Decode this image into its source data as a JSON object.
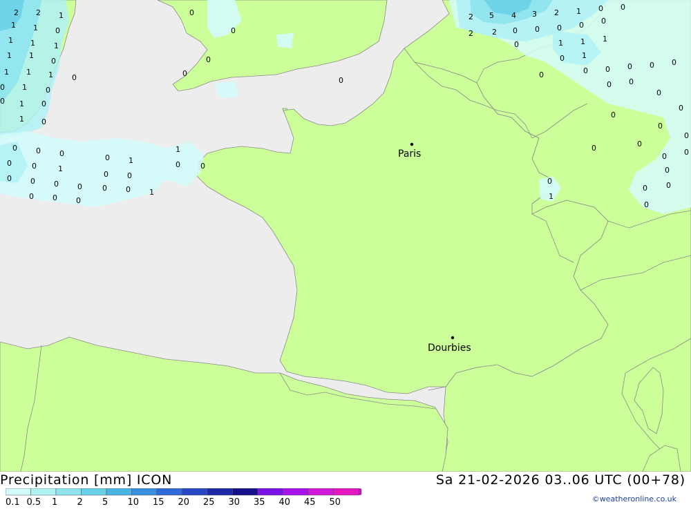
{
  "title": {
    "left": "Precipitation [mm] ICON",
    "right": "Sa 21-02-2026 03..06 UTC (00+78)"
  },
  "credit": "©weatheronline.co.uk",
  "colors": {
    "sea": "#ededed",
    "land": "#ccff99",
    "border": "#8a8a8a",
    "label_text": "#000000"
  },
  "legend": {
    "labels": [
      "0.1",
      "0.5",
      "1",
      "2",
      "5",
      "10",
      "15",
      "20",
      "25",
      "30",
      "35",
      "40",
      "45",
      "50"
    ],
    "colors": [
      "#d3fbfb",
      "#b0f1f5",
      "#8ee3ee",
      "#6ad0e8",
      "#4ab4e2",
      "#3a8fde",
      "#3069d8",
      "#2847c4",
      "#1d28a8",
      "#15108a",
      "#7a12e6",
      "#a612e8",
      "#d01ad8",
      "#e418c2",
      "#b418b4"
    ]
  },
  "cities": [
    {
      "name": "Paris"
    },
    {
      "name": "Dourbies"
    }
  ],
  "precip_values": [
    "2",
    "2",
    "1",
    "1",
    "1",
    "0",
    "1",
    "1",
    "1",
    "1",
    "1",
    "0",
    "1",
    "1",
    "1",
    "0",
    "1",
    "0",
    "0",
    "0",
    "1",
    "0",
    "1",
    "0",
    "0",
    "0",
    "0",
    "0",
    "1",
    "1",
    "0",
    "0",
    "1",
    "0",
    "0",
    "0",
    "0",
    "0",
    "0",
    "0",
    "0",
    "0",
    "1",
    "0",
    "0",
    "0",
    "0",
    "0",
    "0",
    "0",
    "0",
    "0",
    "0",
    "1",
    "2",
    "5",
    "4",
    "3",
    "2",
    "1",
    "0",
    "0",
    "2",
    "2",
    "0",
    "0",
    "0",
    "0",
    "0",
    "0",
    "1",
    "1",
    "0",
    "1",
    "1",
    "0",
    "0",
    "0",
    "0",
    "0",
    "0",
    "0",
    "0",
    "0",
    "0",
    "0",
    "0",
    "0",
    "0",
    "0",
    "0",
    "0",
    "0",
    "0",
    "0",
    "0",
    "0",
    "0",
    "0",
    "0"
  ]
}
